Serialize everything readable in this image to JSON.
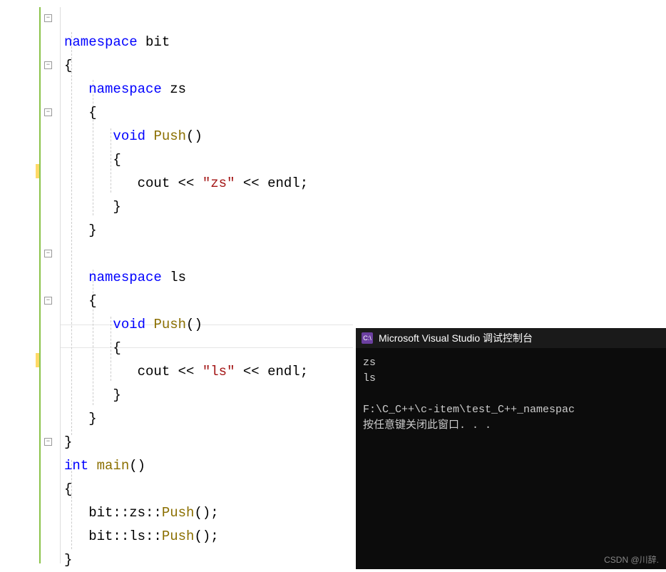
{
  "code": {
    "kw_namespace": "namespace",
    "kw_void": "void",
    "kw_int": "int",
    "ns_bit": "bit",
    "ns_zs": "zs",
    "ns_ls": "ls",
    "fn_push": "Push",
    "fn_main": "main",
    "cout": "cout",
    "endl": "endl",
    "str_zs": "\"zs\"",
    "str_ls": "\"ls\"",
    "op_ins": "<<",
    "call1": "bit::zs::",
    "call2": "bit::ls::",
    "paren": "()",
    "semi": ";",
    "brace_open": "{",
    "brace_close": "}"
  },
  "console": {
    "title": "Microsoft Visual Studio 调试控制台",
    "icon_text": "C:\\",
    "out1": "zs",
    "out2": "ls",
    "path": "F:\\C_C++\\c-item\\test_C++_namespac",
    "prompt": "按任意键关闭此窗口. . ."
  },
  "watermark": "CSDN @川辞."
}
